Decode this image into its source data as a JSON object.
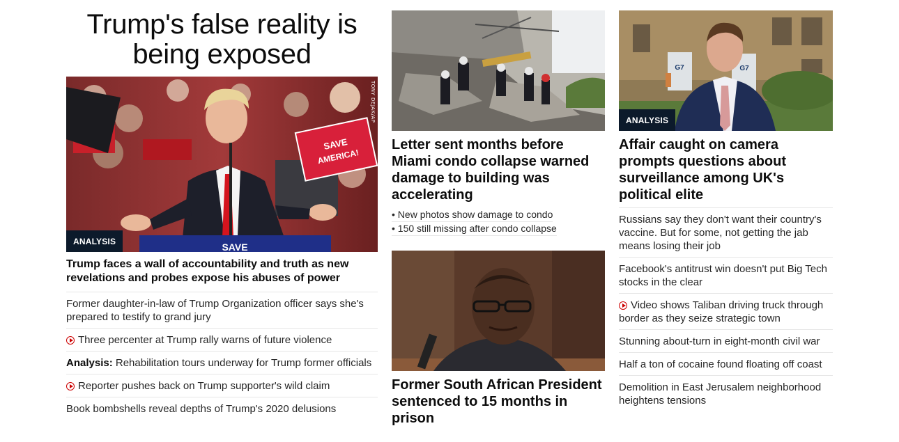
{
  "col1": {
    "banner": "Trump's false reality is being exposed",
    "image": {
      "badge": "ANALYSIS",
      "credit": "TONY DEJAK/AP",
      "sign_text": "SAVE AMERICA!",
      "podium_text": "SAVE"
    },
    "headline": "Trump faces a wall of accountability and truth as new revelations and probes expose his abuses of power",
    "items": [
      {
        "text": "Former daughter-in-law of Trump Organization officer says she's prepared to testify to grand jury"
      },
      {
        "text": "Three percenter at Trump rally warns of future violence",
        "icon": "play-icon"
      },
      {
        "prefix": "Analysis:",
        "text": "Rehabilitation tours underway for Trump former officials"
      },
      {
        "text": "Reporter pushes back on Trump supporter's wild claim",
        "icon": "play-icon"
      },
      {
        "text": "Book bombshells reveal depths of Trump's 2020 delusions"
      }
    ]
  },
  "col2": {
    "story1": {
      "headline": "Letter sent months before Miami condo collapse warned damage to building was accelerating",
      "bullets": [
        "• New photos show damage to condo",
        "• 150 still missing after condo collapse"
      ]
    },
    "story2": {
      "headline": "Former South African President sentenced to 15 months in prison"
    }
  },
  "col3": {
    "image": {
      "badge": "ANALYSIS",
      "sign_text": "G7"
    },
    "headline": "Affair caught on camera prompts questions about surveillance among UK's political elite",
    "items": [
      {
        "text": "Russians say they don't want their country's vaccine. But for some, not getting the jab means losing their job"
      },
      {
        "text": "Facebook's antitrust win doesn't put Big Tech stocks in the clear"
      },
      {
        "text": "Video shows Taliban driving truck through border as they seize strategic town",
        "icon": "play-icon"
      },
      {
        "text": "Stunning about-turn in eight-month civil war"
      },
      {
        "text": "Half a ton of cocaine found floating off coast"
      },
      {
        "text": "Demolition in East Jerusalem neighborhood heightens tensions"
      }
    ]
  },
  "colors": {
    "accent_red": "#cc0000",
    "badge_bg": "#0c1a2b",
    "divider": "#e6e6e6"
  }
}
